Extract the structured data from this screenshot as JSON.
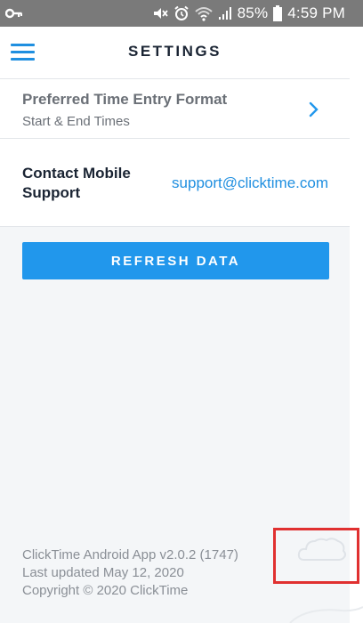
{
  "status_bar": {
    "battery": "85%",
    "time": "4:59 PM",
    "icons": [
      "key-icon",
      "mute-icon",
      "alarm-icon",
      "wifi-icon",
      "signal-icon",
      "battery-icon"
    ]
  },
  "header": {
    "title": "SETTINGS",
    "menu_icon": "hamburger-menu-icon"
  },
  "settings": {
    "time_entry": {
      "title": "Preferred Time Entry Format",
      "value": "Start & End Times"
    },
    "contact": {
      "label": "Contact Mobile Support",
      "email": "support@clicktime.com"
    },
    "refresh_label": "REFRESH DATA"
  },
  "footer": {
    "version": "ClickTime Android App v2.0.2 (1747)",
    "updated": "Last updated May 12, 2020",
    "copyright": "Copyright © 2020 ClickTime"
  },
  "colors": {
    "accent": "#2197ec",
    "link": "#1f8fe0",
    "status_bar": "#7a7a7a",
    "background": "#f4f6f8",
    "highlight": "#e03030"
  }
}
